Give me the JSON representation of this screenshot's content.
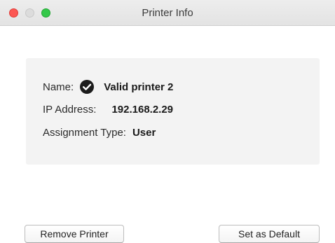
{
  "window": {
    "title": "Printer Info"
  },
  "printer": {
    "name_label": "Name:",
    "name_value": "Valid printer 2",
    "status_icon": "check-circle-icon",
    "ip_label": "IP Address:",
    "ip_value": "192.168.2.29",
    "assignment_label": "Assignment Type:",
    "assignment_value": "User"
  },
  "buttons": {
    "remove_label": "Remove Printer",
    "default_label": "Set as Default"
  },
  "colors": {
    "close": "#fc5753",
    "minimize_disabled": "#dcdcdc",
    "maximize": "#34c84a",
    "panel_bg": "#f3f3f3"
  }
}
